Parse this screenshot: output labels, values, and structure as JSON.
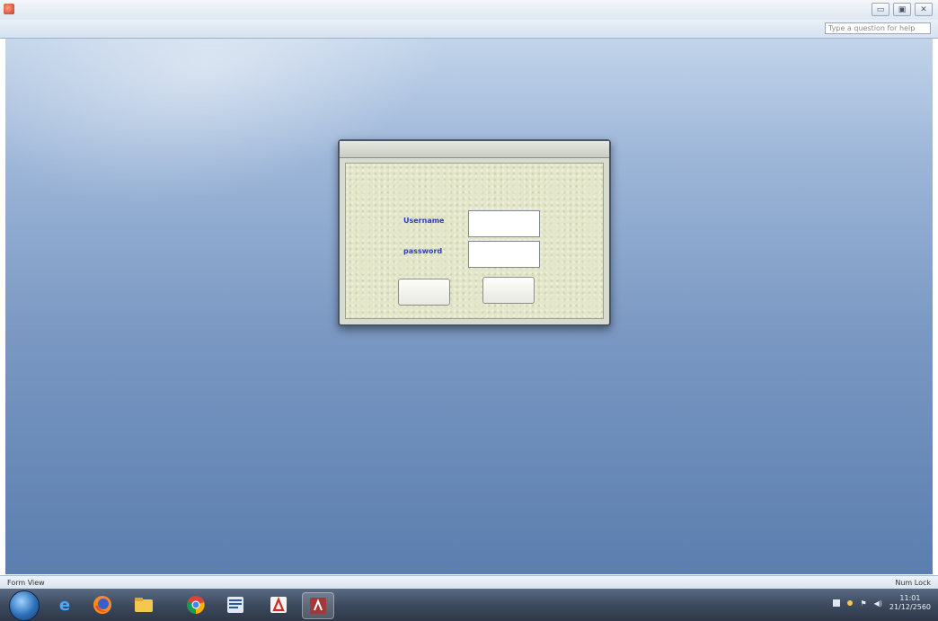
{
  "window": {
    "title": "",
    "minimize_glyph": "▭",
    "maximize_glyph": "▣",
    "close_glyph": "✕"
  },
  "menubar": {
    "items": [
      "",
      "",
      "",
      "",
      "",
      "",
      ""
    ],
    "help_placeholder": "Type a question for help"
  },
  "dialog": {
    "title": "",
    "heading": "",
    "username_label": "Username",
    "password_label": "password",
    "username_value": "",
    "password_value": "",
    "ok_button": "",
    "cancel_button": ""
  },
  "statusbar": {
    "left": "Form View",
    "right": "Num Lock"
  },
  "taskbar": {
    "icons": [
      "windows-start-icon",
      "internet-explorer-icon",
      "firefox-icon",
      "file-explorer-icon",
      "chrome-icon",
      "word-icon",
      "acrobat-icon",
      "access-icon"
    ],
    "clock_time": "11:01",
    "clock_date": "21/12/2560"
  },
  "colors": {
    "workspace_top": "#c2d4ea",
    "workspace_bottom": "#5b7eaf",
    "dialog_body": "#e4e6c9",
    "field_label": "#2b3cc4"
  }
}
